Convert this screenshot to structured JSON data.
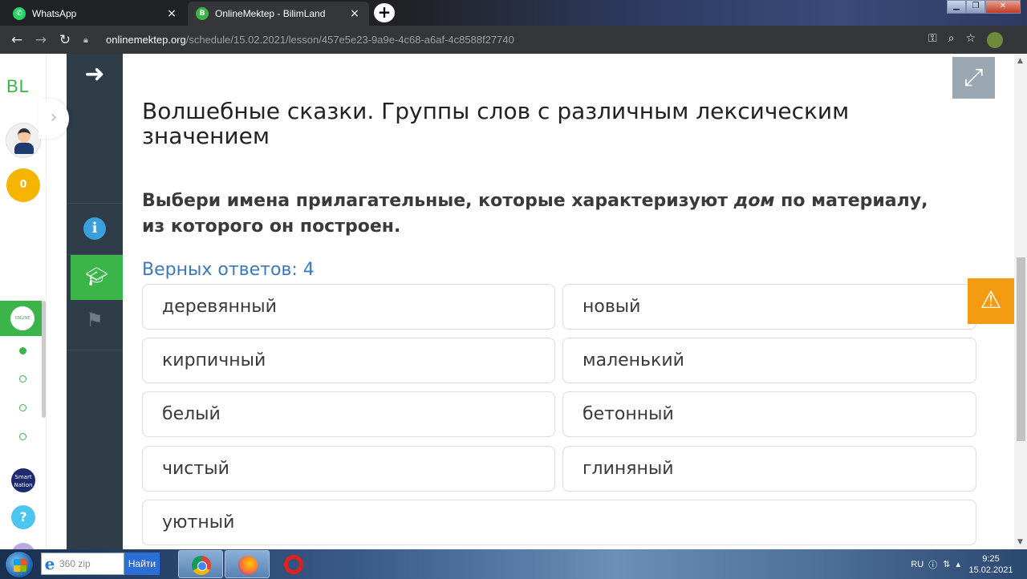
{
  "browser": {
    "tabs": [
      {
        "title": "WhatsApp",
        "close": "×",
        "color": "#25d366"
      },
      {
        "title": "OnlineMektep - BilimLand",
        "close": "×",
        "color": "#3bb54a"
      }
    ],
    "new_tab": "+",
    "url_host": "onlinemektep.org",
    "url_path": "/schedule/15.02.2021/lesson/457e5e23-9a9e-4c68-a6af-4c8588f27740"
  },
  "sidebar": {
    "logo": "BL",
    "score": "0",
    "expand_icon": "chevron-right-icon"
  },
  "lesson": {
    "title": "Волшебные сказки. Группы слов с различным лексическим значением",
    "question_before": "Выбери имена прилагательные, которые характеризуют ",
    "question_emph": "дом",
    "question_after": " по материалу, из которого он построен.",
    "correct_label": "Верных ответов: 4",
    "answers": [
      "деревянный",
      "новый",
      "кирпичный",
      "маленький",
      "белый",
      "бетонный",
      "чистый",
      "глиняный",
      "уютный"
    ]
  },
  "taskbar": {
    "search_text": "360 zip",
    "find_label": "Найти",
    "lang": "RU",
    "time": "9:25",
    "date": "15.02.2021"
  },
  "colors": {
    "accent_green": "#3bb54a",
    "nav_dark": "#2f3d48",
    "link_blue": "#3d79b8",
    "warning_orange": "#f39c12"
  }
}
